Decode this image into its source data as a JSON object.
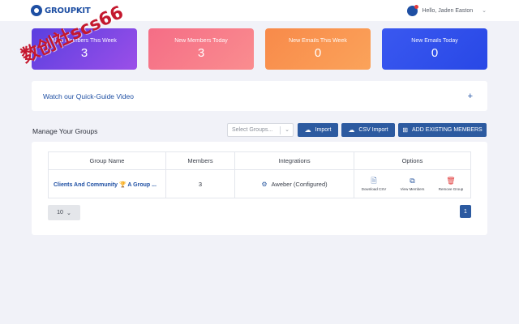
{
  "header": {
    "brand_name": "GROUPKIT",
    "greeting": "Hello, Jaden Easton"
  },
  "stats": [
    {
      "label": "New Members This Week",
      "value": "3"
    },
    {
      "label": "New Members Today",
      "value": "3"
    },
    {
      "label": "New Emails This Week",
      "value": "0"
    },
    {
      "label": "New Emails Today",
      "value": "0"
    }
  ],
  "watermark": "数创社scs66",
  "guide": {
    "title": "Watch our Quick-Guide Video",
    "toggle": "+"
  },
  "manage": {
    "title": "Manage Your Groups",
    "select_placeholder": "Select Groups...",
    "import_label": "Import",
    "csv_import_label": "CSV Import",
    "add_existing_label": "ADD EXISTING MEMBERS"
  },
  "table": {
    "headers": [
      "Group Name",
      "Members",
      "Integrations",
      "Options"
    ],
    "rows": [
      {
        "group_name": "Clients And Community 🏆 A Group ...",
        "members": "3",
        "integration": "Aweber (Configured)",
        "options": {
          "download": "Download CSV",
          "view": "View Members",
          "remove": "Remove Group"
        }
      }
    ]
  },
  "pagination": {
    "per_page": "10",
    "current_page": "1"
  },
  "colors": {
    "accent": "#2c5aa0",
    "brand": "#1e4fa3",
    "danger": "#e03535"
  }
}
